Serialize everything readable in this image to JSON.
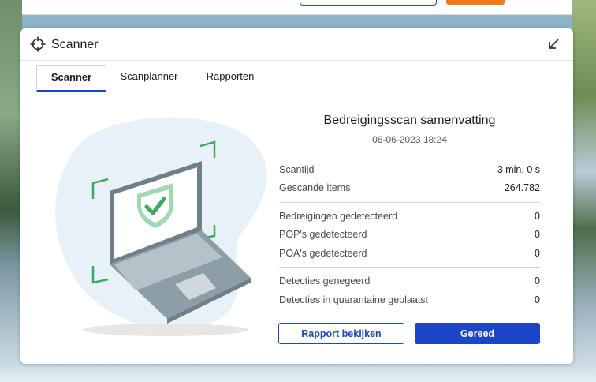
{
  "window": {
    "title": "Scanner"
  },
  "tabs": [
    {
      "label": "Scanner",
      "active": true
    },
    {
      "label": "Scanplanner",
      "active": false
    },
    {
      "label": "Rapporten",
      "active": false
    }
  ],
  "summary": {
    "title": "Bedreigingsscan samenvatting",
    "date": "06-06-2023 18:24",
    "rows": [
      {
        "label": "Scantijd",
        "value": "3 min, 0 s"
      },
      {
        "label": "Gescande items",
        "value": "264.782"
      },
      {
        "label": "Bedreigingen gedetecteerd",
        "value": "0"
      },
      {
        "label": "POP's gedetecteerd",
        "value": "0"
      },
      {
        "label": "POA's gedetecteerd",
        "value": "0"
      },
      {
        "label": "Detecties genegeerd",
        "value": "0"
      },
      {
        "label": "Detecties in quarantaine geplaatst",
        "value": "0"
      }
    ]
  },
  "buttons": {
    "view_report": "Rapport bekijken",
    "done": "Gereed"
  },
  "colors": {
    "accent": "#1c46c7",
    "shield_green": "#3daa5c",
    "orange": "#f07a1a"
  },
  "icons": {
    "title": "crosshair-icon",
    "collapse": "arrow-down-left-icon"
  }
}
